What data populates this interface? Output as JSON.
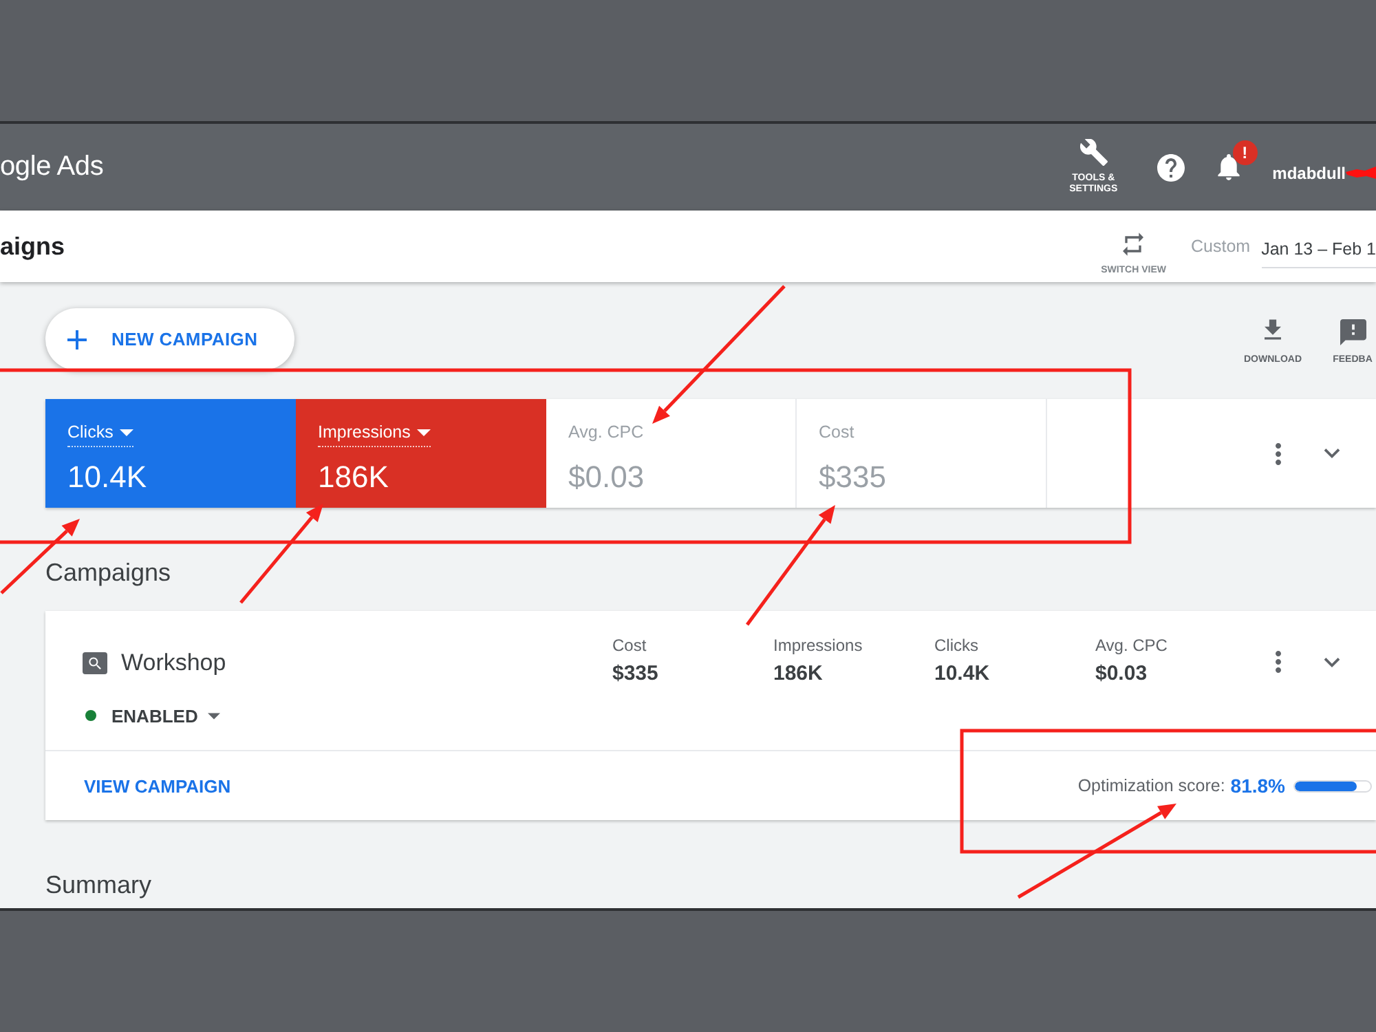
{
  "header": {
    "logo_text": "ogle Ads",
    "tools_label": "TOOLS & SETTINGS",
    "notification_badge": "!",
    "account_name": "mdabdull"
  },
  "title_bar": {
    "title": "aigns",
    "switch_view_label": "SWITCH VIEW",
    "date_preset": "Custom",
    "date_range": "Jan 13 – Feb 1"
  },
  "new_campaign_button": "NEW CAMPAIGN",
  "toolbar": [
    {
      "kind": "download",
      "label": "DOWNLOAD"
    },
    {
      "kind": "feedback",
      "label": "FEEDBA"
    }
  ],
  "metrics": [
    {
      "label": "Clicks",
      "value": "10.4K",
      "selected": true,
      "color": "#1a73e8"
    },
    {
      "label": "Impressions",
      "value": "186K",
      "selected": true,
      "color": "#d93025"
    },
    {
      "label": "Avg. CPC",
      "value": "$0.03",
      "selected": false
    },
    {
      "label": "Cost",
      "value": "$335",
      "selected": false
    }
  ],
  "campaigns_heading": "Campaigns",
  "campaign": {
    "name": "Workshop",
    "status": "ENABLED",
    "stats": [
      {
        "label": "Cost",
        "value": "$335"
      },
      {
        "label": "Impressions",
        "value": "186K"
      },
      {
        "label": "Clicks",
        "value": "10.4K"
      },
      {
        "label": "Avg. CPC",
        "value": "$0.03"
      }
    ],
    "link": "VIEW CAMPAIGN",
    "optimization": {
      "label": "Optimization score:",
      "value": "81.8%",
      "level": 0.818
    }
  },
  "summary_heading": "Summary"
}
